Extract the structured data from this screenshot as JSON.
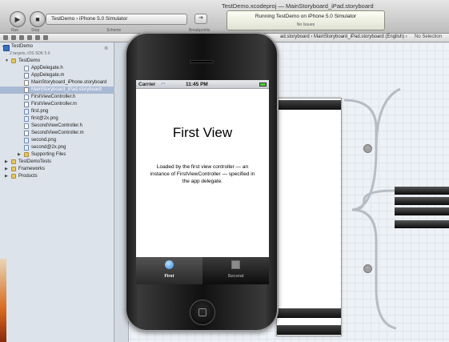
{
  "toolbar": {
    "run_label": "Run",
    "stop_label": "Stop",
    "scheme": "TestDemo  ›  iPhone 5.0 Simulator",
    "scheme_label": "Scheme",
    "breakpoints_label": "Breakpoints",
    "window_title": "TestDemo.xcodeproj — MainStoryboard_iPad.storyboard",
    "status_main": "Running TestDemo on iPhone 5.0 Simulator",
    "status_sub": "No Issues"
  },
  "jumpbar": {
    "path": "ad.storyboard  ›  MainStoryboard_iPad.storyboard (English)  ›",
    "no_selection": "No Selection"
  },
  "navigator": {
    "project": "TestDemo",
    "project_sub": "2 targets, iOS SDK 5.0",
    "items": [
      {
        "label": "TestDemo",
        "kind": "folder"
      },
      {
        "label": "AppDelegate.h",
        "kind": "h"
      },
      {
        "label": "AppDelegate.m",
        "kind": "m"
      },
      {
        "label": "MainStoryboard_iPhone.storyboard",
        "kind": "storyboard"
      },
      {
        "label": "MainStoryboard_iPad.storyboard",
        "kind": "storyboard",
        "selected": true
      },
      {
        "label": "FirstViewController.h",
        "kind": "h"
      },
      {
        "label": "FirstViewController.m",
        "kind": "m"
      },
      {
        "label": "first.png",
        "kind": "png"
      },
      {
        "label": "first@2x.png",
        "kind": "png"
      },
      {
        "label": "SecondViewController.h",
        "kind": "h"
      },
      {
        "label": "SecondViewController.m",
        "kind": "m"
      },
      {
        "label": "second.png",
        "kind": "png"
      },
      {
        "label": "second@2x.png",
        "kind": "png"
      },
      {
        "label": "Supporting Files",
        "kind": "folder"
      },
      {
        "label": "TestDemoTests",
        "kind": "folder"
      },
      {
        "label": "Frameworks",
        "kind": "folder"
      },
      {
        "label": "Products",
        "kind": "folder"
      }
    ]
  },
  "simulator": {
    "carrier": "Carrier",
    "time": "11:45 PM",
    "title": "First View",
    "description": "Loaded by the first view controller — an instance of FirstViewController — specified in the app delegate.",
    "tabs": [
      {
        "label": "First",
        "icon": "circle-icon",
        "active": true
      },
      {
        "label": "Second",
        "icon": "square-icon",
        "active": false
      }
    ]
  },
  "colors": {
    "selection": "#a8b9d3",
    "tab_active_icon": "#2b86e0",
    "battery": "#4cd133"
  }
}
